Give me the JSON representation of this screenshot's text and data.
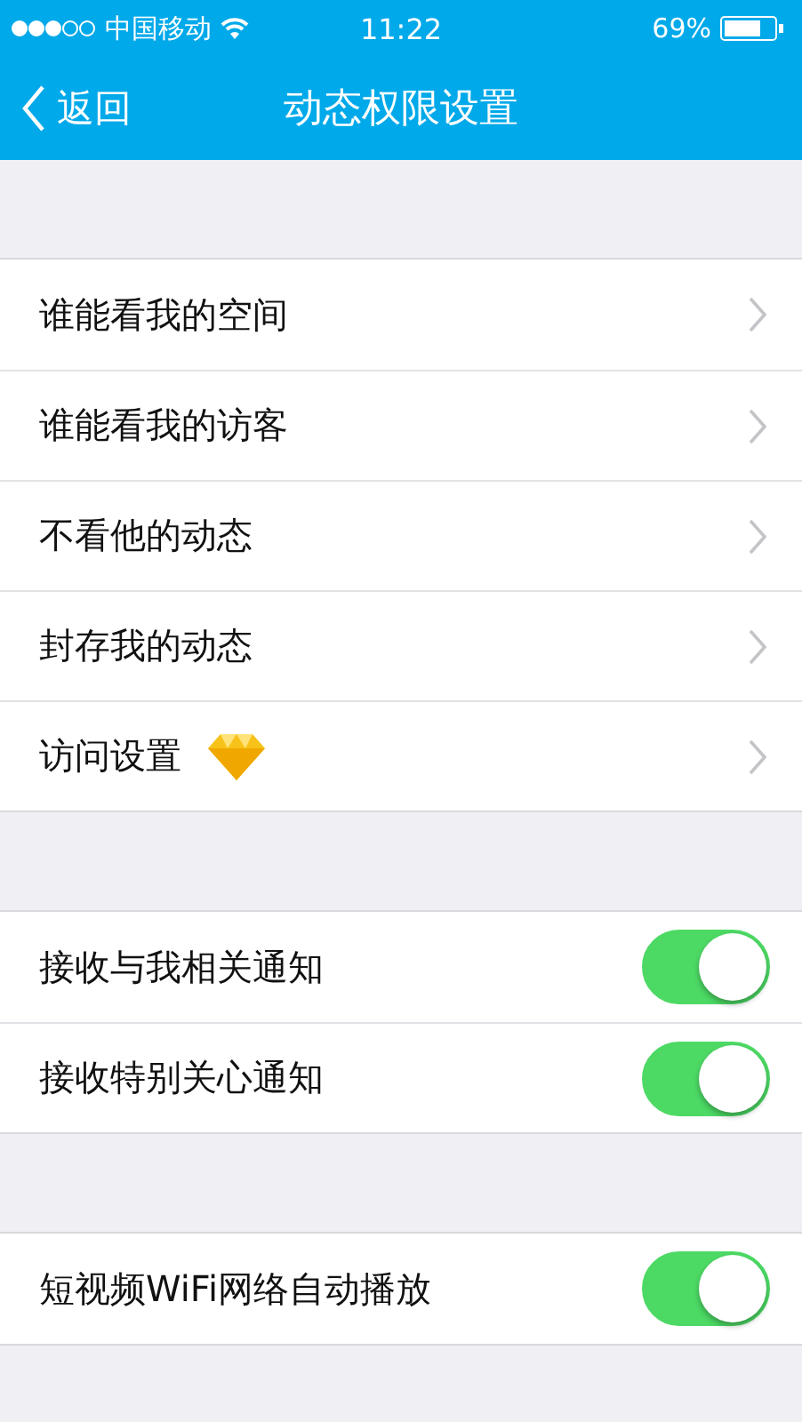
{
  "status_bar": {
    "carrier": "中国移动",
    "time": "11:22",
    "battery": "69%"
  },
  "nav": {
    "back": "返回",
    "title": "动态权限设置"
  },
  "sections": [
    {
      "items": [
        {
          "kind": "link",
          "label": "谁能看我的空间",
          "badge": false
        },
        {
          "kind": "link",
          "label": "谁能看我的访客",
          "badge": false
        },
        {
          "kind": "link",
          "label": "不看他的动态",
          "badge": false
        },
        {
          "kind": "link",
          "label": "封存我的动态",
          "badge": false
        },
        {
          "kind": "link",
          "label": "访问设置",
          "badge": true
        }
      ]
    },
    {
      "items": [
        {
          "kind": "toggle",
          "label": "接收与我相关通知",
          "on": true
        },
        {
          "kind": "toggle",
          "label": "接收特别关心通知",
          "on": true
        }
      ]
    },
    {
      "items": [
        {
          "kind": "toggle",
          "label": "短视频WiFi网络自动播放",
          "on": true
        }
      ]
    }
  ]
}
